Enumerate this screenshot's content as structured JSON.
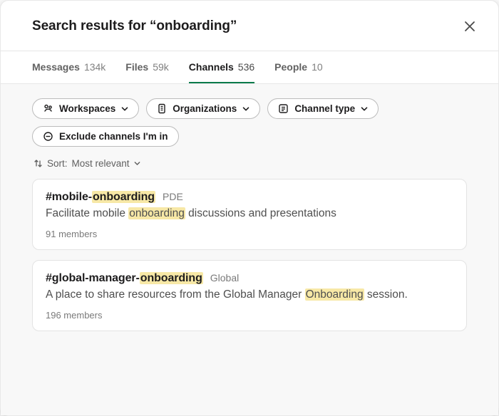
{
  "header": {
    "title": "Search results for “onboarding”"
  },
  "tabs": [
    {
      "label": "Messages",
      "count": "134k"
    },
    {
      "label": "Files",
      "count": "59k"
    },
    {
      "label": "Channels",
      "count": "536"
    },
    {
      "label": "People",
      "count": "10"
    }
  ],
  "filters": {
    "workspaces": "Workspaces",
    "organizations": "Organizations",
    "channel_type": "Channel type",
    "exclude": "Exclude channels I'm in"
  },
  "sort": {
    "prefix": "Sort:",
    "value": "Most relevant"
  },
  "results": [
    {
      "name_prefix": "#mobile-",
      "name_highlight": "onboarding",
      "tag": "PDE",
      "desc_before": "Facilitate mobile ",
      "desc_highlight": "onboarding",
      "desc_after": " discussions and presentations",
      "members": "91 members"
    },
    {
      "name_prefix": "#global-manager-",
      "name_highlight": "onboarding",
      "tag": "Global",
      "desc_before": "A place to share resources from the Global Manager ",
      "desc_highlight": "Onboarding",
      "desc_after": " session.",
      "members": "196 members"
    }
  ]
}
